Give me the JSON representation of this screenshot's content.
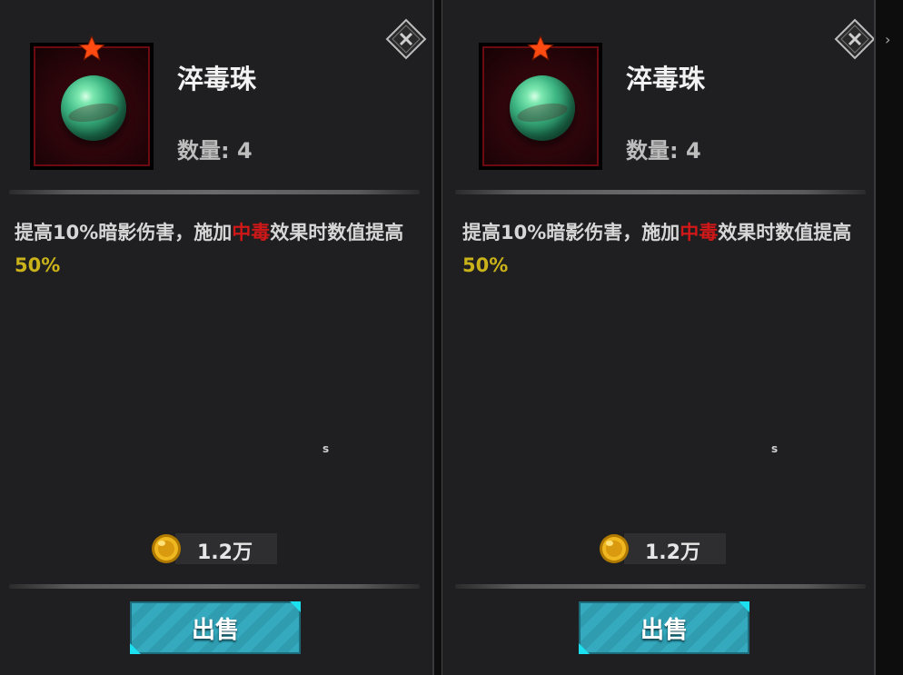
{
  "cards": [
    {
      "item_name": "淬毒珠",
      "quantity": "数量: 4",
      "desc_part1": "提高10%暗影伤害，施加",
      "desc_hl_red": "中毒",
      "desc_part2": "效果时数值提高",
      "desc_hl_yellow": "50%",
      "tiny_label": "s",
      "price": "1.2万",
      "sell_label": "出售"
    },
    {
      "item_name": "淬毒珠",
      "quantity": "数量: 4",
      "desc_part1": "提高10%暗影伤害，施加",
      "desc_hl_red": "中毒",
      "desc_part2": "效果时数值提高",
      "desc_hl_yellow": "50%",
      "tiny_label": "s",
      "price": "1.2万",
      "sell_label": "出售"
    }
  ],
  "colors": {
    "highlight_red": "#d01818",
    "highlight_yellow": "#c9b21a",
    "button": "#35a9bd"
  },
  "icons": [
    "star-icon",
    "close-icon",
    "coin-icon",
    "poison-orb-icon"
  ],
  "edge_arrow": "›"
}
